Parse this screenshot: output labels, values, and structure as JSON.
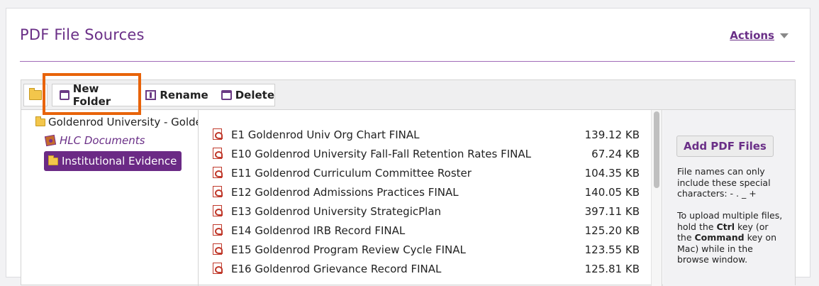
{
  "header": {
    "title": "PDF File Sources",
    "actions_label": "Actions"
  },
  "toolbar": {
    "new_folder_label": "New Folder",
    "rename_label": "Rename",
    "delete_label": "Delete"
  },
  "tree": {
    "root_label": "Goldenrod University - Golde",
    "children": [
      {
        "label": "HLC Documents"
      },
      {
        "label": "Institutional Evidence",
        "selected": true
      }
    ]
  },
  "files": [
    {
      "name": "E1 Goldenrod Univ Org Chart FINAL",
      "size": "139.12 KB"
    },
    {
      "name": "E10 Goldenrod University Fall-Fall Retention Rates FINAL",
      "size": "67.24 KB"
    },
    {
      "name": "E11 Goldenrod Curriculum Committee Roster",
      "size": "104.35 KB"
    },
    {
      "name": "E12 Goldenrod Admissions Practices FINAL",
      "size": "140.05 KB"
    },
    {
      "name": "E13 Goldenrod University StrategicPlan",
      "size": "397.11 KB"
    },
    {
      "name": "E14 Goldenrod IRB Record FINAL",
      "size": "125.20 KB"
    },
    {
      "name": "E15 Goldenrod Program Review Cycle FINAL",
      "size": "123.55 KB"
    },
    {
      "name": "E16 Goldenrod Grievance Record FINAL",
      "size": "125.81 KB"
    }
  ],
  "side_panel": {
    "add_button_label": "Add PDF Files",
    "note1": "File names can only include these special characters: - . _ +",
    "note2_pre": "To upload multiple files, hold the ",
    "note2_ctrl": "Ctrl",
    "note2_mid": " key (or the ",
    "note2_cmd": "Command",
    "note2_post": " key on Mac) while in the browse window."
  },
  "colors": {
    "brand_purple": "#6a2f87",
    "highlight_orange": "#e8630a",
    "selected_bg": "#6b2a85"
  }
}
